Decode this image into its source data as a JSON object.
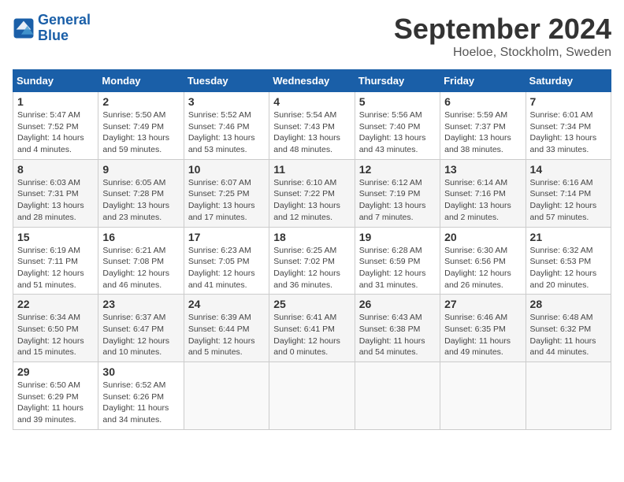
{
  "header": {
    "logo_line1": "General",
    "logo_line2": "Blue",
    "month": "September 2024",
    "location": "Hoeloe, Stockholm, Sweden"
  },
  "weekdays": [
    "Sunday",
    "Monday",
    "Tuesday",
    "Wednesday",
    "Thursday",
    "Friday",
    "Saturday"
  ],
  "weeks": [
    [
      {
        "day": "1",
        "info": "Sunrise: 5:47 AM\nSunset: 7:52 PM\nDaylight: 14 hours\nand 4 minutes."
      },
      {
        "day": "2",
        "info": "Sunrise: 5:50 AM\nSunset: 7:49 PM\nDaylight: 13 hours\nand 59 minutes."
      },
      {
        "day": "3",
        "info": "Sunrise: 5:52 AM\nSunset: 7:46 PM\nDaylight: 13 hours\nand 53 minutes."
      },
      {
        "day": "4",
        "info": "Sunrise: 5:54 AM\nSunset: 7:43 PM\nDaylight: 13 hours\nand 48 minutes."
      },
      {
        "day": "5",
        "info": "Sunrise: 5:56 AM\nSunset: 7:40 PM\nDaylight: 13 hours\nand 43 minutes."
      },
      {
        "day": "6",
        "info": "Sunrise: 5:59 AM\nSunset: 7:37 PM\nDaylight: 13 hours\nand 38 minutes."
      },
      {
        "day": "7",
        "info": "Sunrise: 6:01 AM\nSunset: 7:34 PM\nDaylight: 13 hours\nand 33 minutes."
      }
    ],
    [
      {
        "day": "8",
        "info": "Sunrise: 6:03 AM\nSunset: 7:31 PM\nDaylight: 13 hours\nand 28 minutes."
      },
      {
        "day": "9",
        "info": "Sunrise: 6:05 AM\nSunset: 7:28 PM\nDaylight: 13 hours\nand 23 minutes."
      },
      {
        "day": "10",
        "info": "Sunrise: 6:07 AM\nSunset: 7:25 PM\nDaylight: 13 hours\nand 17 minutes."
      },
      {
        "day": "11",
        "info": "Sunrise: 6:10 AM\nSunset: 7:22 PM\nDaylight: 13 hours\nand 12 minutes."
      },
      {
        "day": "12",
        "info": "Sunrise: 6:12 AM\nSunset: 7:19 PM\nDaylight: 13 hours\nand 7 minutes."
      },
      {
        "day": "13",
        "info": "Sunrise: 6:14 AM\nSunset: 7:16 PM\nDaylight: 13 hours\nand 2 minutes."
      },
      {
        "day": "14",
        "info": "Sunrise: 6:16 AM\nSunset: 7:14 PM\nDaylight: 12 hours\nand 57 minutes."
      }
    ],
    [
      {
        "day": "15",
        "info": "Sunrise: 6:19 AM\nSunset: 7:11 PM\nDaylight: 12 hours\nand 51 minutes."
      },
      {
        "day": "16",
        "info": "Sunrise: 6:21 AM\nSunset: 7:08 PM\nDaylight: 12 hours\nand 46 minutes."
      },
      {
        "day": "17",
        "info": "Sunrise: 6:23 AM\nSunset: 7:05 PM\nDaylight: 12 hours\nand 41 minutes."
      },
      {
        "day": "18",
        "info": "Sunrise: 6:25 AM\nSunset: 7:02 PM\nDaylight: 12 hours\nand 36 minutes."
      },
      {
        "day": "19",
        "info": "Sunrise: 6:28 AM\nSunset: 6:59 PM\nDaylight: 12 hours\nand 31 minutes."
      },
      {
        "day": "20",
        "info": "Sunrise: 6:30 AM\nSunset: 6:56 PM\nDaylight: 12 hours\nand 26 minutes."
      },
      {
        "day": "21",
        "info": "Sunrise: 6:32 AM\nSunset: 6:53 PM\nDaylight: 12 hours\nand 20 minutes."
      }
    ],
    [
      {
        "day": "22",
        "info": "Sunrise: 6:34 AM\nSunset: 6:50 PM\nDaylight: 12 hours\nand 15 minutes."
      },
      {
        "day": "23",
        "info": "Sunrise: 6:37 AM\nSunset: 6:47 PM\nDaylight: 12 hours\nand 10 minutes."
      },
      {
        "day": "24",
        "info": "Sunrise: 6:39 AM\nSunset: 6:44 PM\nDaylight: 12 hours\nand 5 minutes."
      },
      {
        "day": "25",
        "info": "Sunrise: 6:41 AM\nSunset: 6:41 PM\nDaylight: 12 hours\nand 0 minutes."
      },
      {
        "day": "26",
        "info": "Sunrise: 6:43 AM\nSunset: 6:38 PM\nDaylight: 11 hours\nand 54 minutes."
      },
      {
        "day": "27",
        "info": "Sunrise: 6:46 AM\nSunset: 6:35 PM\nDaylight: 11 hours\nand 49 minutes."
      },
      {
        "day": "28",
        "info": "Sunrise: 6:48 AM\nSunset: 6:32 PM\nDaylight: 11 hours\nand 44 minutes."
      }
    ],
    [
      {
        "day": "29",
        "info": "Sunrise: 6:50 AM\nSunset: 6:29 PM\nDaylight: 11 hours\nand 39 minutes."
      },
      {
        "day": "30",
        "info": "Sunrise: 6:52 AM\nSunset: 6:26 PM\nDaylight: 11 hours\nand 34 minutes."
      },
      {
        "day": "",
        "info": ""
      },
      {
        "day": "",
        "info": ""
      },
      {
        "day": "",
        "info": ""
      },
      {
        "day": "",
        "info": ""
      },
      {
        "day": "",
        "info": ""
      }
    ]
  ]
}
